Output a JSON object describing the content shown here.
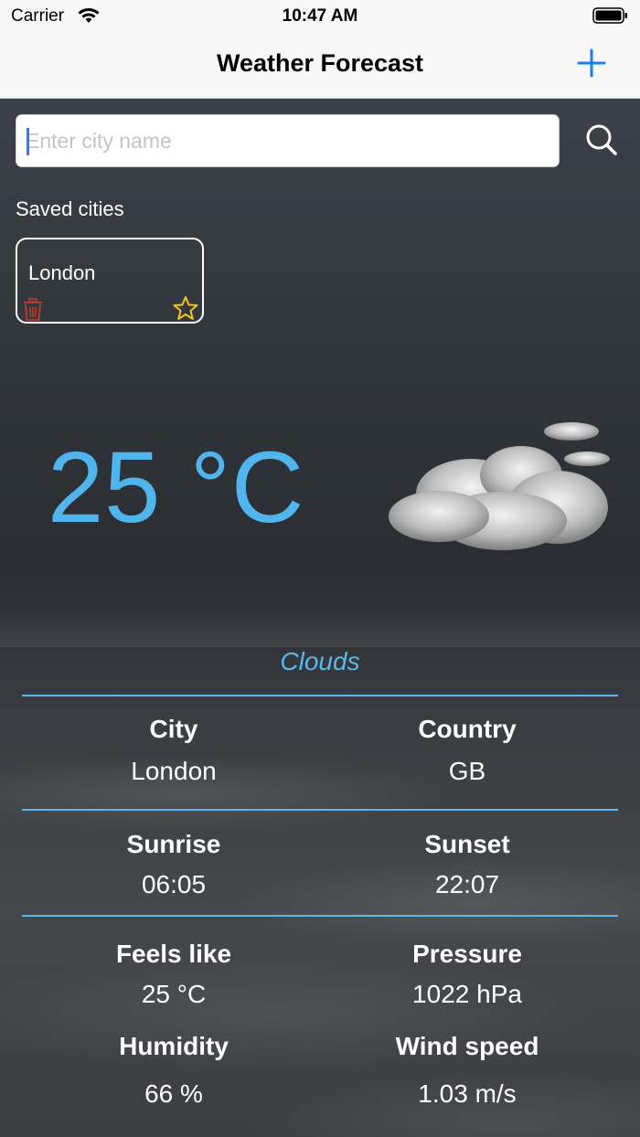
{
  "status_bar": {
    "carrier": "Carrier",
    "time": "10:47 AM"
  },
  "nav": {
    "title": "Weather Forecast"
  },
  "search": {
    "placeholder": "Enter city name",
    "value": ""
  },
  "saved": {
    "label": "Saved cities",
    "cities": [
      {
        "name": "London"
      }
    ]
  },
  "weather": {
    "temperature": "25 °C",
    "condition": "Clouds",
    "icon": "cloud-icon"
  },
  "details": {
    "city_label": "City",
    "city_value": "London",
    "country_label": "Country",
    "country_value": "GB",
    "sunrise_label": "Sunrise",
    "sunrise_value": "06:05",
    "sunset_label": "Sunset",
    "sunset_value": "22:07",
    "feels_like_label": "Feels like",
    "feels_like_value": "25 °C",
    "pressure_label": "Pressure",
    "pressure_value": "1022 hPa",
    "humidity_label": "Humidity",
    "humidity_value": "66 %",
    "wind_label": "Wind speed",
    "wind_value": "1.03 m/s"
  },
  "colors": {
    "accent": "#4fb5ec",
    "nav_button": "#1a7ff5",
    "trash": "#c0392b",
    "star": "#f5c518"
  }
}
